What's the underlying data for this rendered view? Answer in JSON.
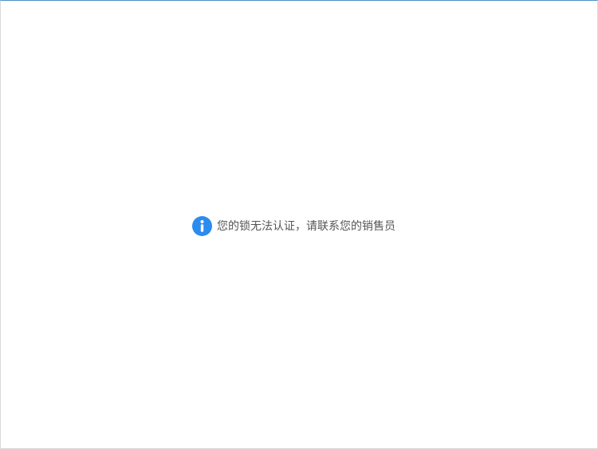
{
  "colors": {
    "accent": "#2c8bef",
    "text": "#555555",
    "border_top": "#4a90c8"
  },
  "notice": {
    "icon": "info-icon",
    "text": "您的锁无法认证，请联系您的销售员"
  }
}
